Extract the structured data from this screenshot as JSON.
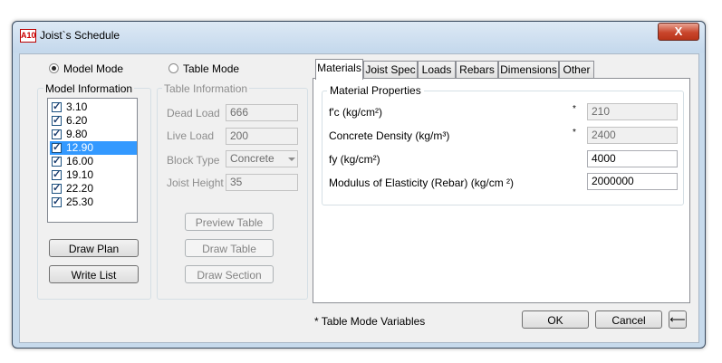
{
  "window": {
    "app_icon_text": "A10",
    "title": "Joist`s Schedule",
    "close_glyph": "X"
  },
  "modes": {
    "model_mode_label": "Model Mode",
    "table_mode_label": "Table Mode",
    "selected": "Model Mode"
  },
  "model_info": {
    "title": "Model Information",
    "items": [
      {
        "label": "3.10",
        "checked": true,
        "selected": false
      },
      {
        "label": "6.20",
        "checked": true,
        "selected": false
      },
      {
        "label": "9.80",
        "checked": true,
        "selected": false
      },
      {
        "label": "12.90",
        "checked": true,
        "selected": true
      },
      {
        "label": "16.00",
        "checked": true,
        "selected": false
      },
      {
        "label": "19.10",
        "checked": true,
        "selected": false
      },
      {
        "label": "22.20",
        "checked": true,
        "selected": false
      },
      {
        "label": "25.30",
        "checked": true,
        "selected": false
      }
    ],
    "draw_plan_label": "Draw Plan",
    "write_list_label": "Write List"
  },
  "table_info": {
    "title": "Table Information",
    "dead_load_label": "Dead Load",
    "dead_load_value": "666",
    "live_load_label": "Live Load",
    "live_load_value": "200",
    "block_type_label": "Block Type",
    "block_type_value": "Concrete",
    "joist_height_label": "Joist Height",
    "joist_height_value": "35",
    "preview_table_label": "Preview Table",
    "draw_table_label": "Draw Table",
    "draw_section_label": "Draw Section"
  },
  "tabs": [
    {
      "label": "Materials",
      "active": true
    },
    {
      "label": "Joist Spec",
      "active": false
    },
    {
      "label": "Loads",
      "active": false
    },
    {
      "label": "Rebars",
      "active": false
    },
    {
      "label": "Dimensions",
      "active": false
    },
    {
      "label": "Other",
      "active": false
    }
  ],
  "materials": {
    "group_title": "Material Properties",
    "fc_label": "f'c (kg/cm²)",
    "fc_value": "210",
    "density_label": "Concrete Density (kg/m³)",
    "density_value": "2400",
    "fy_label": "fy (kg/cm²)",
    "fy_value": "4000",
    "modulus_label": "Modulus of Elasticity (Rebar) (kg/cm ²)",
    "modulus_value": "2000000",
    "star": "*"
  },
  "footer": {
    "note": "* Table Mode Variables",
    "ok_label": "OK",
    "cancel_label": "Cancel",
    "back_glyph": "⟵"
  }
}
